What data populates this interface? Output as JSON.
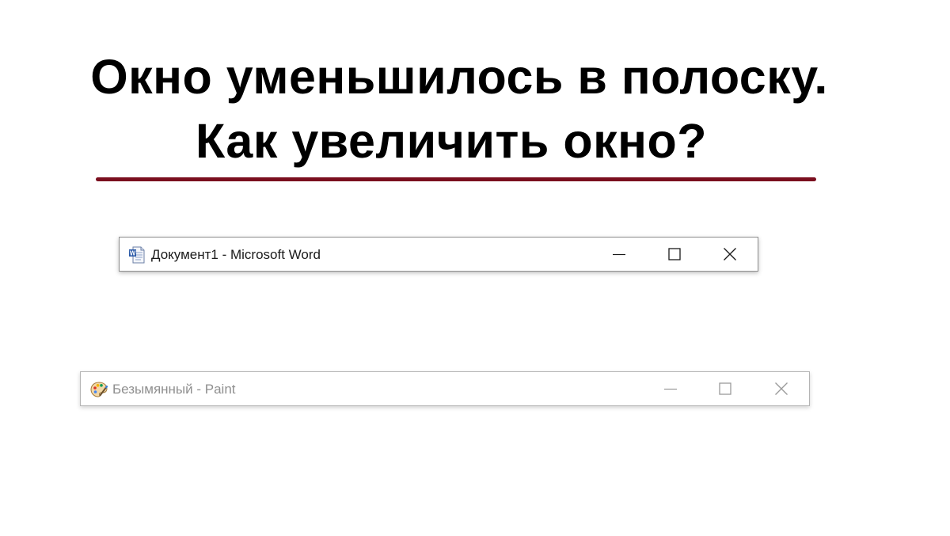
{
  "headline": {
    "line1": "Окно уменьшилось в полоску.",
    "line2": "Как увеличить окно?"
  },
  "colors": {
    "rule": "#7a0e1e",
    "active_controls": "#1a1a1a",
    "inactive_controls": "#9a9a9a"
  },
  "windows": [
    {
      "title": "Документ1 - Microsoft Word",
      "icon": "word-document-icon",
      "state": "active",
      "controls": [
        "minimize-icon",
        "maximize-icon",
        "close-icon"
      ]
    },
    {
      "title": "Безымянный - Paint",
      "icon": "paint-palette-icon",
      "state": "inactive",
      "controls": [
        "minimize-icon",
        "maximize-icon",
        "close-icon"
      ]
    }
  ]
}
